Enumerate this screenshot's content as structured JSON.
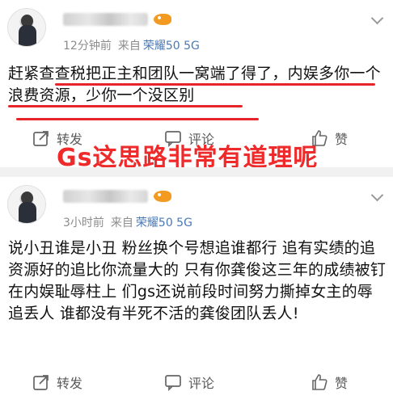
{
  "posts": [
    {
      "time": "12分钟前",
      "source_prefix": "来自",
      "device": "荣耀50 5G",
      "body": "赶紧查查税把正主和团队一窝端了得了，内娱多你一个浪费资源，少你一个没区别",
      "actions": {
        "repost": "转发",
        "comment": "评论",
        "like": "赞"
      }
    },
    {
      "time": "3小时前",
      "source_prefix": "来自",
      "device": "荣耀50 5G",
      "body": "说小丑谁是小丑 粉丝换个号想追谁都行 追有实绩的追资源好的追比你流量大的 只有你龚俊这三年的成绩被钉在内娱耻辱柱上 们gs还说前段时间努力撕掉女主的辱追丢人 谁都没有半死不活的龚俊团队丢人!",
      "actions": {
        "repost": "转发",
        "comment": "评论",
        "like": "赞"
      }
    }
  ],
  "overlay_caption": "Gs这思路非常有道理呢",
  "colors": {
    "accent_red": "#e8242b",
    "device_blue": "#4b79b5",
    "meta_gray": "#8c8c8c"
  }
}
